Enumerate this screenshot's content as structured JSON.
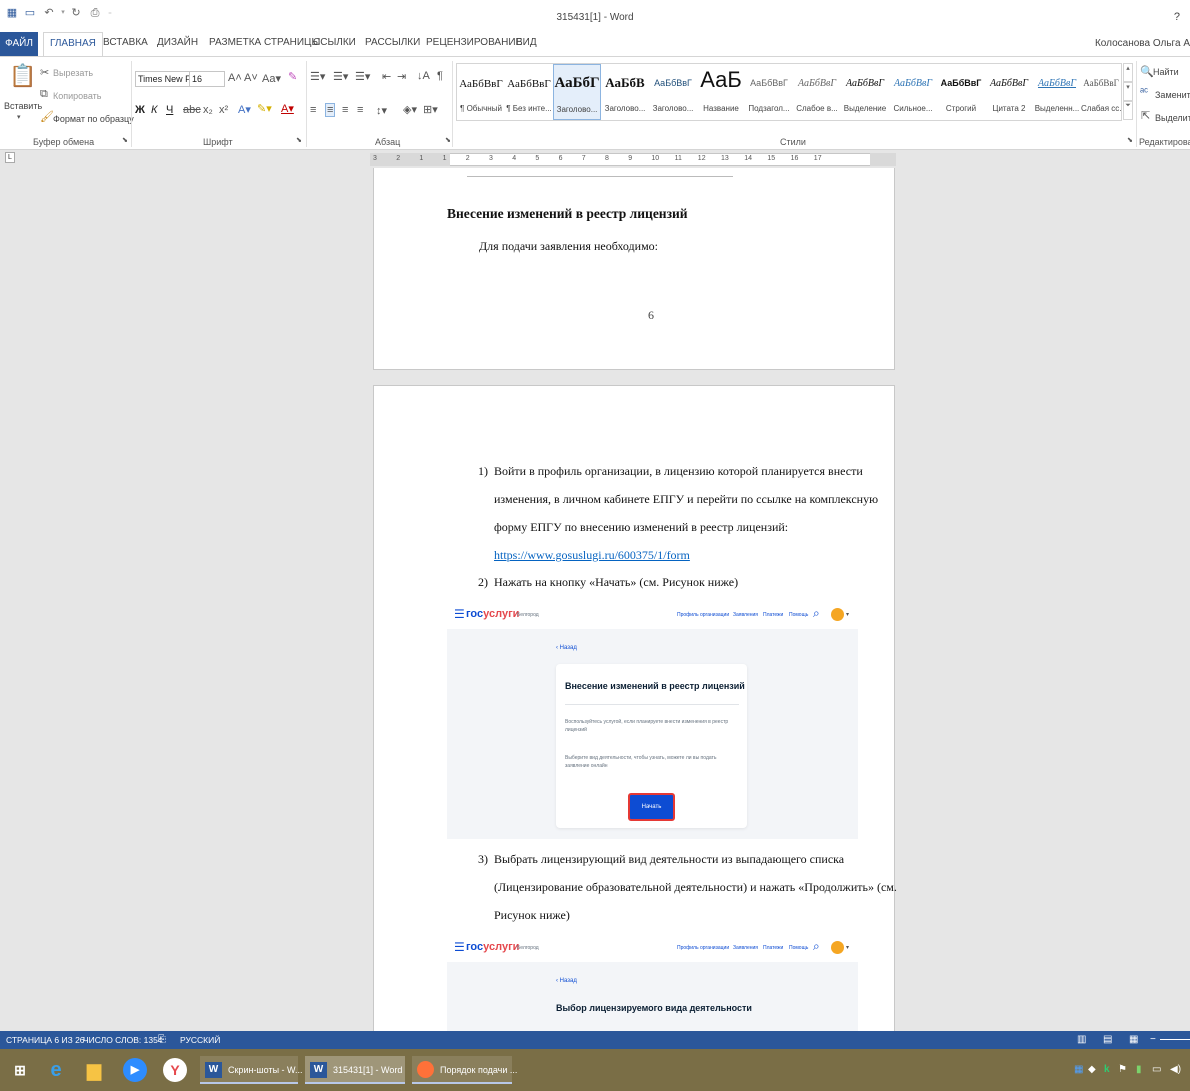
{
  "window": {
    "title": "315431[1] - Word",
    "help": "?"
  },
  "ribbon_tabs": [
    "ФАЙЛ",
    "ГЛАВНАЯ",
    "ВСТАВКА",
    "ДИЗАЙН",
    "РАЗМЕТКА СТРАНИЦЫ",
    "ССЫЛКИ",
    "РАССЫЛКИ",
    "РЕЦЕНЗИРОВАНИЕ",
    "ВИД"
  ],
  "user": "Колосанова Ольга А",
  "clipboard": {
    "paste": "Вставить",
    "cut": "Вырезать",
    "copy": "Копировать",
    "format_painter": "Формат по образцу",
    "group": "Буфер обмена"
  },
  "font": {
    "name": "Times New F",
    "size": "16",
    "group": "Шрифт",
    "bold": "Ж",
    "italic": "К",
    "underline": "Ч"
  },
  "paragraph": {
    "group": "Абзац"
  },
  "styles": {
    "group": "Стили",
    "items": [
      {
        "sample": "АаБбВвГ",
        "name": "¶ Обычный"
      },
      {
        "sample": "АаБбВвГ",
        "name": "¶ Без инте..."
      },
      {
        "sample": "АаБбГ",
        "name": "Заголово..."
      },
      {
        "sample": "АаБбВ",
        "name": "Заголово..."
      },
      {
        "sample": "АаБбВвГ",
        "name": "Заголово..."
      },
      {
        "sample": "АаБ",
        "name": "Название"
      },
      {
        "sample": "АаБбВвГ",
        "name": "Подзагол..."
      },
      {
        "sample": "АаБбВвГ",
        "name": "Слабое в..."
      },
      {
        "sample": "АаБбВвГ",
        "name": "Выделение"
      },
      {
        "sample": "АаБбВвГ",
        "name": "Сильное..."
      },
      {
        "sample": "АаБбВвГ",
        "name": "Строгий"
      },
      {
        "sample": "АаБбВвГ",
        "name": "Цитата 2"
      },
      {
        "sample": "АаБбВвГ",
        "name": "Выделенн..."
      },
      {
        "sample": "АаБбВвГ",
        "name": "Слабая сс..."
      }
    ]
  },
  "editing": {
    "find": "Найти",
    "replace": "Заменить",
    "select": "Выделить",
    "group": "Редактирован"
  },
  "ruler": {
    "corner": "L",
    "ticks": [
      "3",
      "2",
      "1",
      "1",
      "2",
      "3",
      "4",
      "5",
      "6",
      "7",
      "8",
      "9",
      "10",
      "11",
      "12",
      "13",
      "14",
      "15",
      "16",
      "17"
    ]
  },
  "page1": {
    "heading": "Внесение изменений в реестр лицензий",
    "text": "Для подачи заявления необходимо:",
    "page_number": "6"
  },
  "steps": [
    {
      "num": "1)",
      "lines": [
        "Войти в профиль организации, в лицензию которой планируется внести",
        "изменения, в личном кабинете ЕПГУ и перейти по ссылке на комплексную",
        "форму ЕПГУ по внесению изменений в реестр лицензий:"
      ],
      "link": "https://www.gosuslugi.ru/600375/1/form"
    },
    {
      "num": "2)",
      "lines": [
        "Нажать на кнопку «Начать» (см. Рисунок ниже)"
      ]
    },
    {
      "num": "3)",
      "lines": [
        "Выбрать лицензирующий вид деятельности из выпадающего списка",
        "(Лицензирование образовательной деятельности) и нажать «Продолжить» (см.",
        "Рисунок ниже)"
      ]
    }
  ],
  "gosuslugi": {
    "logo_a": "гос",
    "logo_b": "услуги",
    "city": "Белгород",
    "nav": [
      "Профиль организации",
      "Заявления",
      "Платежи",
      "Помощь"
    ],
    "back": "‹ Назад",
    "card_title": "Внесение изменений в реестр лицензий",
    "card_text1": "Воспользуйтесь услугой, если планируете внести изменения в реестр лицензий",
    "card_text2": "Выберите вид деятельности, чтобы узнать, можете ли вы подать заявление онлайн",
    "start_button": "Начать",
    "screen2_title": "Выбор лицензируемого вида деятельности"
  },
  "statusbar": {
    "page": "СТРАНИЦА 6 ИЗ 26",
    "words": "ЧИСЛО СЛОВ: 1354",
    "language": "РУССКИЙ"
  },
  "taskbar": {
    "windows": [
      {
        "label": "Скрин-шоты - W..."
      },
      {
        "label": "315431[1] - Word"
      },
      {
        "label": "Порядок подачи ..."
      }
    ]
  }
}
